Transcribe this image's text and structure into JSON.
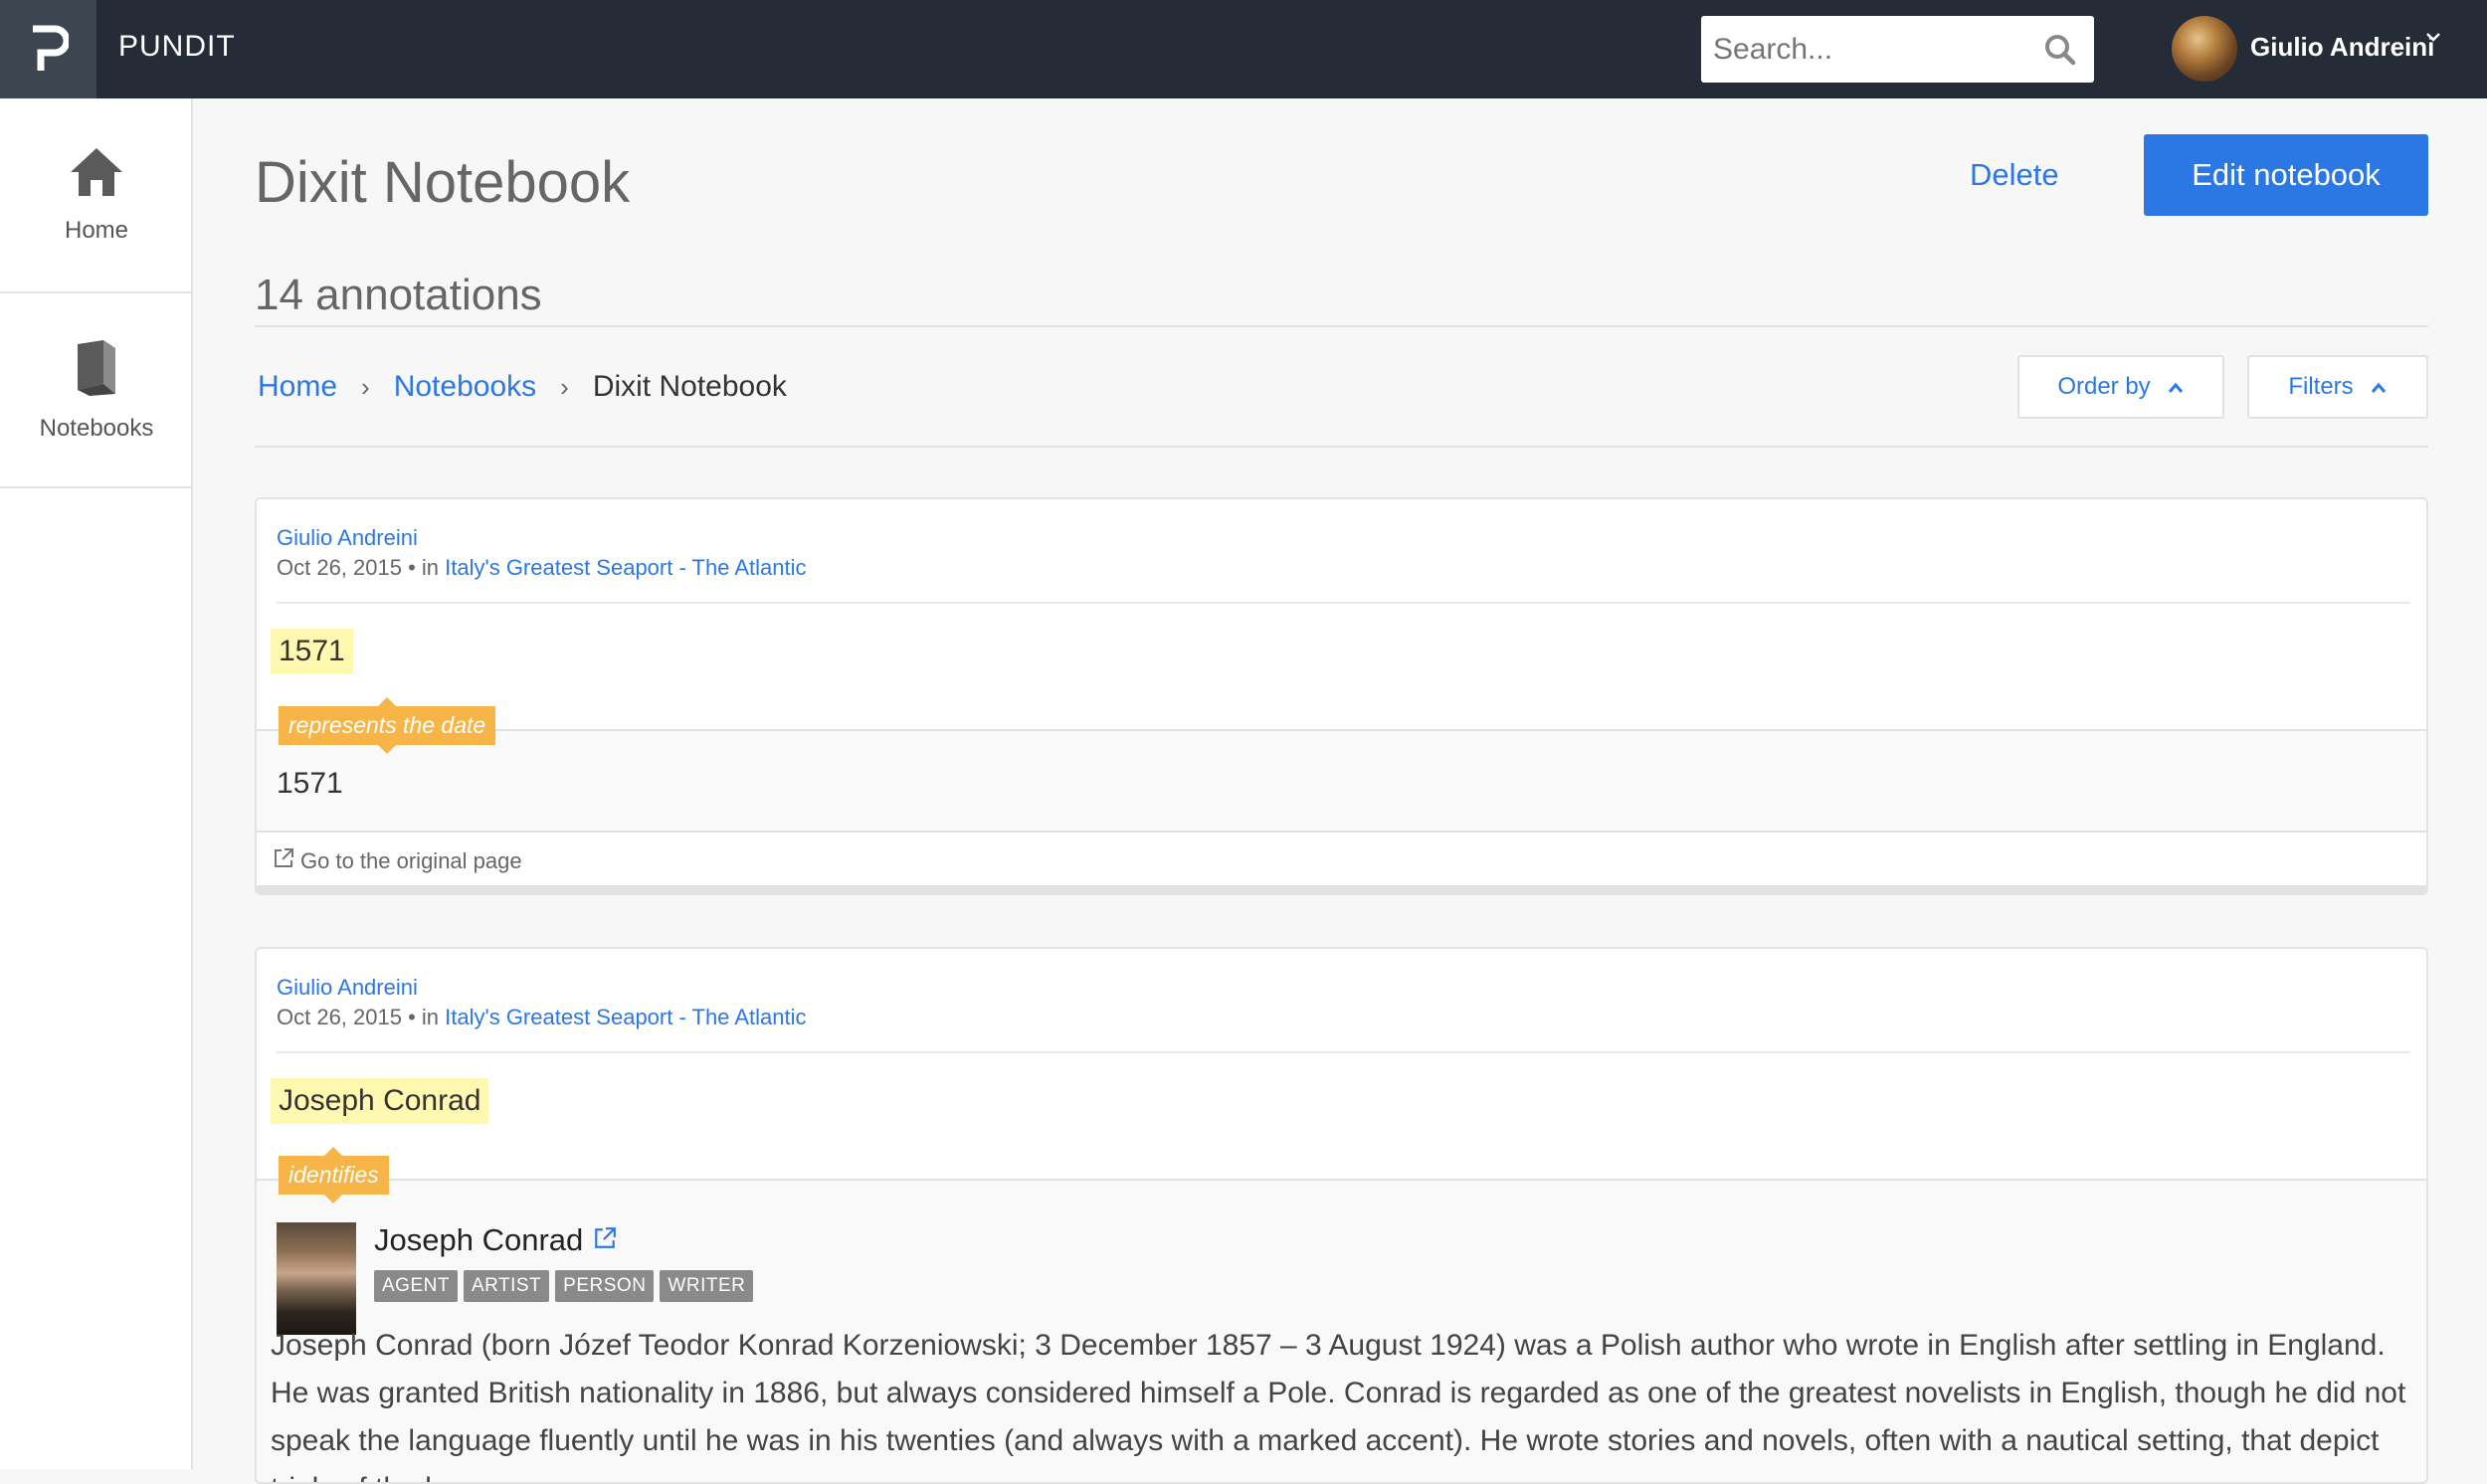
{
  "app": {
    "brand": "PUNDIT"
  },
  "search": {
    "placeholder": "Search..."
  },
  "user": {
    "name": "Giulio Andreini"
  },
  "sidebar": {
    "items": [
      {
        "label": "Home"
      },
      {
        "label": "Notebooks"
      }
    ]
  },
  "page": {
    "title": "Dixit Notebook",
    "delete_label": "Delete",
    "edit_label": "Edit notebook",
    "count": "14 annotations"
  },
  "breadcrumb": {
    "home": "Home",
    "notebooks": "Notebooks",
    "current": "Dixit Notebook"
  },
  "controls": {
    "order_by": "Order by",
    "filters": "Filters"
  },
  "annotations": [
    {
      "author": "Giulio Andreini",
      "date": "Oct 26, 2015",
      "in_label": " • in ",
      "source": "Italy's Greatest Seaport - The Atlantic",
      "subject": "1571",
      "predicate": "represents the date",
      "object": "1571",
      "goto": "Go to the original page"
    },
    {
      "author": "Giulio Andreini",
      "date": "Oct 26, 2015",
      "in_label": " • in ",
      "source": "Italy's Greatest Seaport - The Atlantic",
      "subject": "Joseph Conrad",
      "predicate": "identifies",
      "entity_name": "Joseph Conrad",
      "tags": [
        "AGENT",
        "ARTIST",
        "PERSON",
        "WRITER"
      ],
      "description": "Joseph Conrad (born Józef Teodor Konrad Korzeniowski; 3 December 1857 – 3 August 1924) was a Polish author who wrote in English after settling in England. He was granted British nationality in 1886, but always considered himself a Pole. Conrad is regarded as one of the greatest novelists in English, though he did not speak the language fluently until he was in his twenties (and always with a marked accent). He wrote stories and novels, often with a nautical setting, that depict trials of the human"
    }
  ],
  "colors": {
    "topbar": "#252c37",
    "accent": "#2b78e4",
    "predicate": "#f7b547",
    "highlight": "#fff8b0"
  }
}
